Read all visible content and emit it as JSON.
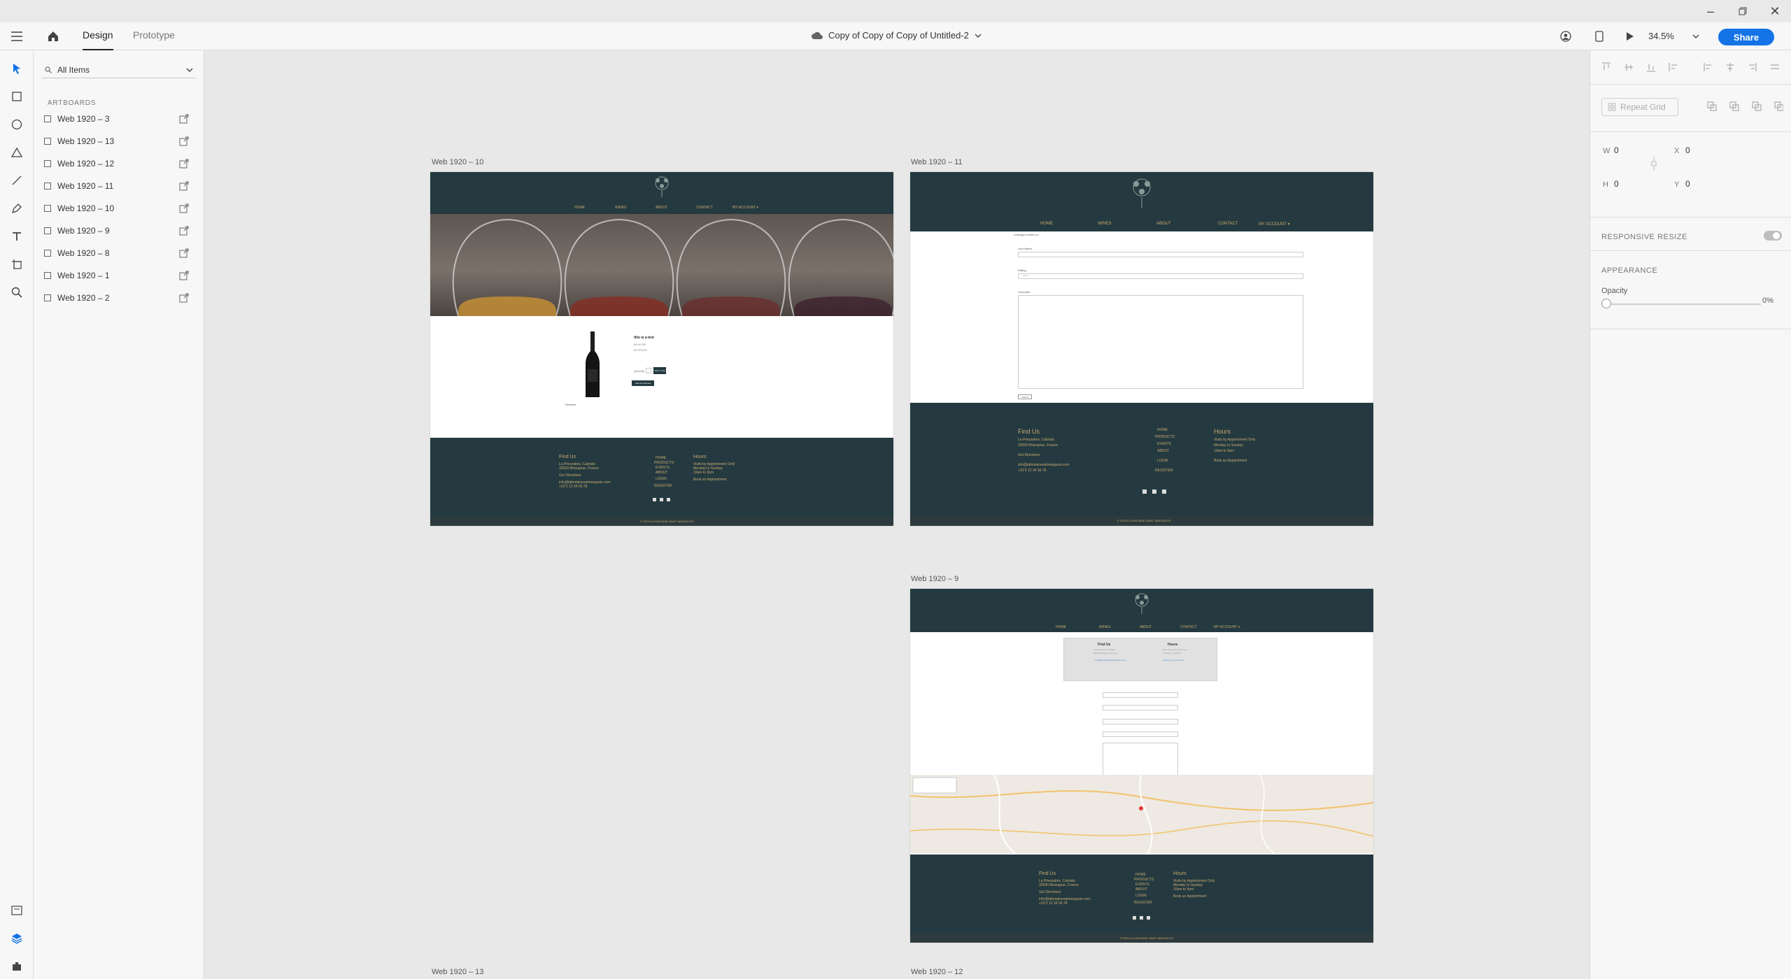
{
  "app": {
    "document_title": "Copy of Copy of Copy of Untitled-2",
    "tabs": [
      "Design",
      "Prototype"
    ],
    "zoom": "34.5%",
    "share_label": "Share"
  },
  "layers": {
    "search_placeholder": "All Items",
    "section_label": "ARTBOARDS",
    "items": [
      "Web 1920 – 3",
      "Web 1920 – 13",
      "Web 1920 – 12",
      "Web 1920 – 11",
      "Web 1920 – 10",
      "Web 1920 – 9",
      "Web 1920 – 8",
      "Web 1920 – 1",
      "Web 1920 – 2"
    ]
  },
  "canvas": {
    "artboard_labels": [
      "Web 1920 – 10",
      "Web 1920 – 11",
      "Web 1920 – 9",
      "Web 1920 – 13",
      "Web 1920 – 12"
    ],
    "site": {
      "nav": [
        "HOME",
        "WINES",
        "ABOUT",
        "CONTACT",
        "MY ACCOUNT ▾"
      ],
      "find_us_title": "Find Us",
      "hours_title": "Hours",
      "address_1": "La Prieuraites, Cabrials",
      "address_2": "32000 Mirangnac, France",
      "get_directions": "Get Directions",
      "email": "info@lafontainesatmargaute.com",
      "phone": "+33 5 12 34 56 78",
      "footer_links": [
        "HOME",
        "PRODUCTS",
        "EVENTS",
        "ABOUT",
        "LOGIN",
        "REGISTER"
      ],
      "hours_1": "Visits by Appointment Only",
      "hours_2": "Monday to Sunday",
      "hours_3": "10am to 5pm",
      "book": "Book an Appointment",
      "copyright": "© 2020 LA FONTAINE SAINT MARGAUTE",
      "product_name": "this is a test",
      "product_price": "£0.00 GB",
      "in_stock": "IN STOCK",
      "qty_label": "Quantity",
      "add_btn": "Add to Cart",
      "submit_btn": "Submit a Review",
      "reviews": "Reviews",
      "review_heading": "Leaving a review on",
      "form_name": "Your Name",
      "form_rating": "Rating",
      "form_rating_placeholder": "Select...",
      "form_comment": "Comment",
      "form_submit": "Submit"
    }
  },
  "props": {
    "repeat_grid": "Repeat Grid",
    "w_label": "W",
    "w_value": "0",
    "h_label": "H",
    "h_value": "0",
    "x_label": "X",
    "x_value": "0",
    "y_label": "Y",
    "y_value": "0",
    "responsive_resize": "RESPONSIVE RESIZE",
    "appearance": "APPEARANCE",
    "opacity_label": "Opacity",
    "opacity_value": "0%"
  },
  "colors": {
    "accent": "#1473e6",
    "site_navy": "#243a40",
    "site_gold": "#c9a96e"
  }
}
